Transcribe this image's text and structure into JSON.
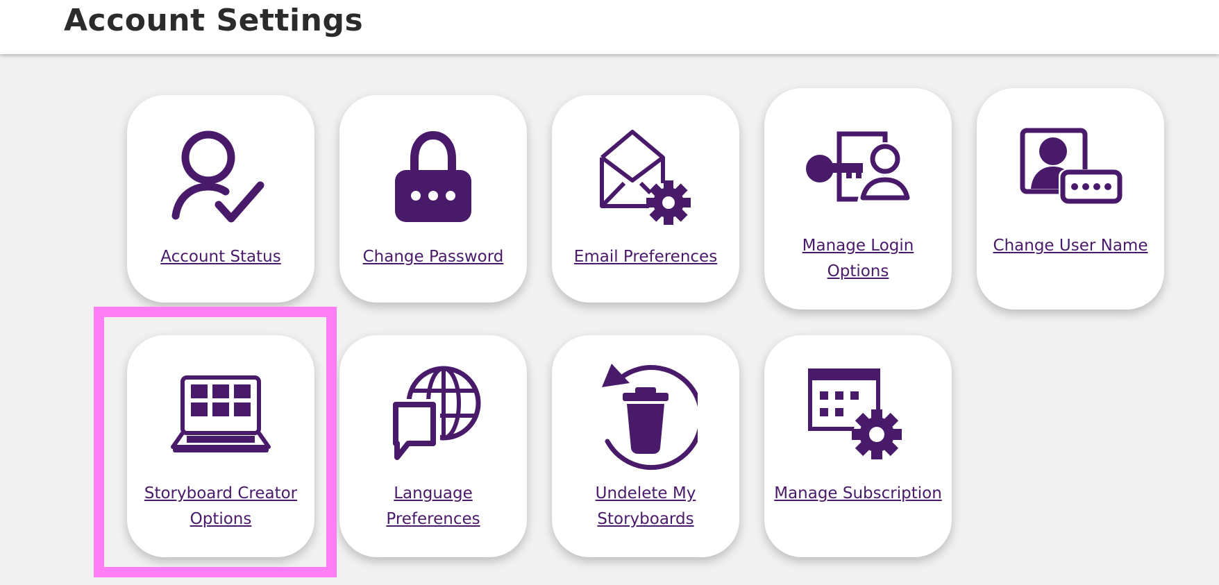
{
  "header": {
    "title": "Account Settings"
  },
  "colors": {
    "accent": "#4a1a6a",
    "highlight": "#ff7ef6",
    "background": "#f1f1f1"
  },
  "cards": [
    {
      "label": "Account Status",
      "icon": "user-check-icon"
    },
    {
      "label": "Change Password",
      "icon": "padlock-icon"
    },
    {
      "label": "Email Preferences",
      "icon": "envelope-gear-icon"
    },
    {
      "label": "Manage Login Options",
      "icon": "key-user-icon"
    },
    {
      "label": "Change User Name",
      "icon": "profile-card-icon"
    },
    {
      "label": "Storyboard Creator Options",
      "icon": "laptop-grid-icon"
    },
    {
      "label": "Language Preferences",
      "icon": "globe-chat-icon"
    },
    {
      "label": "Undelete My Storyboards",
      "icon": "restore-trash-icon"
    },
    {
      "label": "Manage Subscription",
      "icon": "calendar-gear-icon"
    }
  ]
}
